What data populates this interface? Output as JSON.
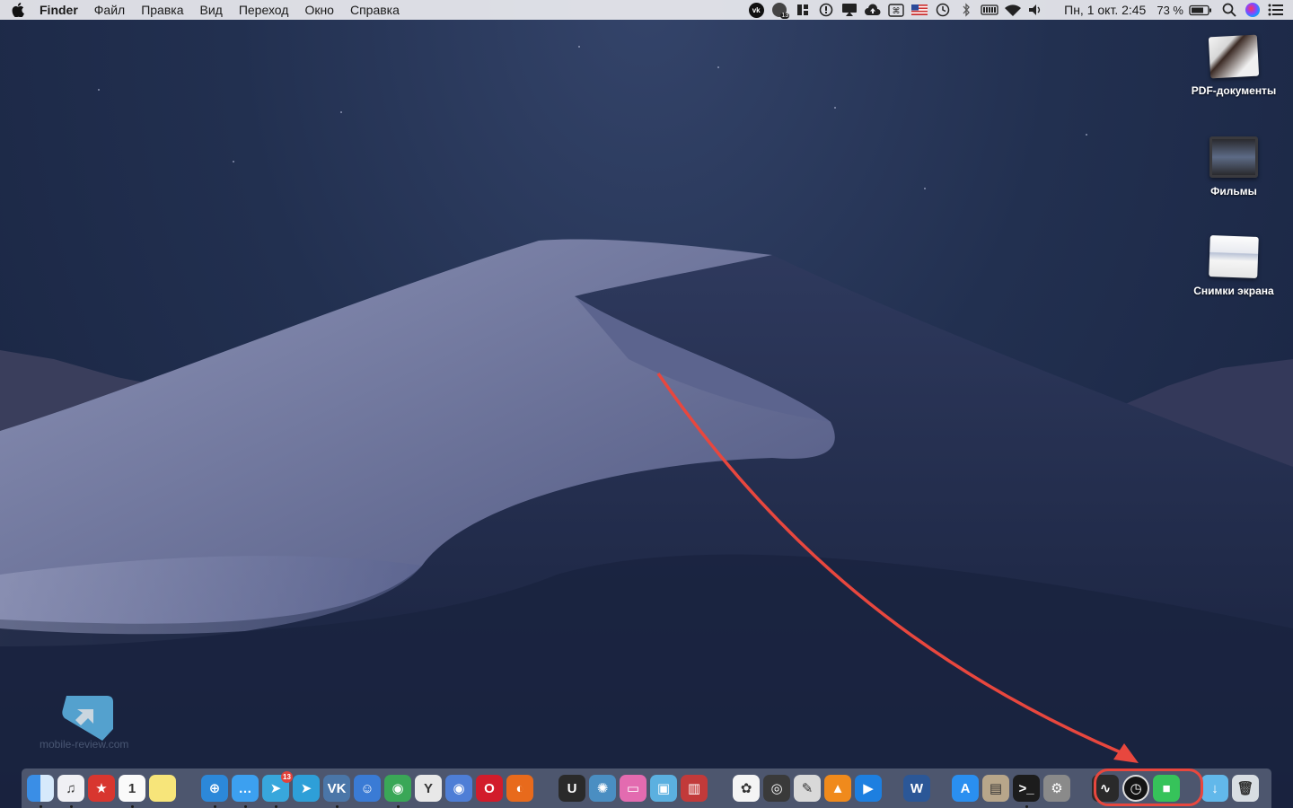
{
  "menubar": {
    "app_name": "Finder",
    "menus": [
      "Файл",
      "Правка",
      "Вид",
      "Переход",
      "Окно",
      "Справка"
    ],
    "status_icons": [
      "vk-icon",
      "messages-badge-icon",
      "bartender-icon",
      "info-icon",
      "airplay-display-icon",
      "cloud-upload-icon",
      "keyboard-cmd-icon",
      "us-flag-icon",
      "time-machine-icon",
      "bluetooth-icon",
      "battery-cells-icon",
      "wifi-icon",
      "volume-icon"
    ],
    "status_badge": "13",
    "datetime": "Пн, 1 окт.  2:45",
    "battery": "73 %",
    "accent": "#ebebf0"
  },
  "desktop": {
    "icons": [
      {
        "label": "PDF-документы",
        "icon": "pdf-stack-icon"
      },
      {
        "label": "Фильмы",
        "icon": "movies-stack-icon"
      },
      {
        "label": "Снимки экрана",
        "icon": "screenshots-stack-icon"
      }
    ],
    "annotation_color": "#e8473e"
  },
  "watermark": {
    "text": "mobile-review.com"
  },
  "dock": {
    "groups": [
      [
        {
          "name": "finder-icon",
          "label": "",
          "color": "#3a8ee6",
          "running": true
        },
        {
          "name": "itunes-icon",
          "label": "♫",
          "color": "#f0f0f4",
          "running": true
        },
        {
          "name": "bookmarks-icon",
          "label": "★",
          "color": "#d8362f",
          "running": false
        },
        {
          "name": "calendar-icon",
          "label": "1",
          "color": "#fafafa",
          "running": true
        },
        {
          "name": "notes-icon",
          "label": "",
          "color": "#f7e57a",
          "running": false
        }
      ],
      [
        {
          "name": "safari-icon",
          "label": "⊕",
          "color": "#2c88d9",
          "running": true
        },
        {
          "name": "messages-icon",
          "label": "…",
          "color": "#3ca0f0",
          "running": true
        },
        {
          "name": "telegram-desktop-icon",
          "label": "➤",
          "color": "#38a7dc",
          "running": true,
          "badge": "13"
        },
        {
          "name": "telegram-icon",
          "label": "➤",
          "color": "#2e9fd8",
          "running": false
        },
        {
          "name": "vk-icon",
          "label": "VK",
          "color": "#4a76a8",
          "running": true
        },
        {
          "name": "surprise-app-icon",
          "label": "☺",
          "color": "#3a7bd5",
          "running": false
        },
        {
          "name": "chrome-icon",
          "label": "◉",
          "color": "#3aa757",
          "running": true
        },
        {
          "name": "yandex-icon",
          "label": "Y",
          "color": "#e8e8e8",
          "running": false
        },
        {
          "name": "chromium-icon",
          "label": "◉",
          "color": "#4e7ed6",
          "running": false
        },
        {
          "name": "opera-icon",
          "label": "O",
          "color": "#d21c2b",
          "running": false
        },
        {
          "name": "firefox-icon",
          "label": "◐",
          "color": "#e86a1c",
          "running": false
        }
      ],
      [
        {
          "name": "ulysses-icon",
          "label": "U",
          "color": "#2a2a2a",
          "running": false
        },
        {
          "name": "app-wheel-icon",
          "label": "✺",
          "color": "#4a8ec2",
          "running": false
        },
        {
          "name": "imac-icon",
          "label": "▭",
          "color": "#e36bb0",
          "running": false
        },
        {
          "name": "screen-sharing-icon",
          "label": "▣",
          "color": "#5bb0e0",
          "running": false
        },
        {
          "name": "photo-booth-icon",
          "label": "▥",
          "color": "#c23a3a",
          "running": false
        }
      ],
      [
        {
          "name": "photos-icon",
          "label": "✿",
          "color": "#f4f4f4",
          "running": false
        },
        {
          "name": "screenshot-app-icon",
          "label": "◎",
          "color": "#3a3a3a",
          "running": false
        },
        {
          "name": "preview-icon",
          "label": "✎",
          "color": "#d9d9d9",
          "running": false
        },
        {
          "name": "vlc-icon",
          "label": "▲",
          "color": "#f08a1c",
          "running": false
        },
        {
          "name": "quicktime-icon",
          "label": "▶",
          "color": "#1d7fe0",
          "running": false
        }
      ],
      [
        {
          "name": "word-icon",
          "label": "W",
          "color": "#2b5797",
          "running": false
        }
      ],
      [
        {
          "name": "app-store-icon",
          "label": "A",
          "color": "#2a8ff0",
          "running": false
        },
        {
          "name": "archive-icon",
          "label": "▤",
          "color": "#b8a68a",
          "running": false
        },
        {
          "name": "terminal-icon",
          "label": ">_",
          "color": "#1c1c1c",
          "running": true
        },
        {
          "name": "system-preferences-icon",
          "label": "⚙",
          "color": "#8a8a8a",
          "running": false
        }
      ],
      [
        {
          "name": "activity-monitor-icon",
          "label": "∿",
          "color": "#2a2a2a",
          "running": false
        },
        {
          "name": "speedtest-icon",
          "label": "◷",
          "color": "#141414",
          "running": false
        },
        {
          "name": "facetime-icon",
          "label": "■",
          "color": "#36c35a",
          "running": false
        }
      ],
      [
        {
          "name": "downloads-folder-icon",
          "label": "↓",
          "color": "#62b8ea",
          "running": false
        },
        {
          "name": "trash-icon",
          "label": "🗑",
          "color": "#d8dde2",
          "running": false
        }
      ]
    ]
  }
}
